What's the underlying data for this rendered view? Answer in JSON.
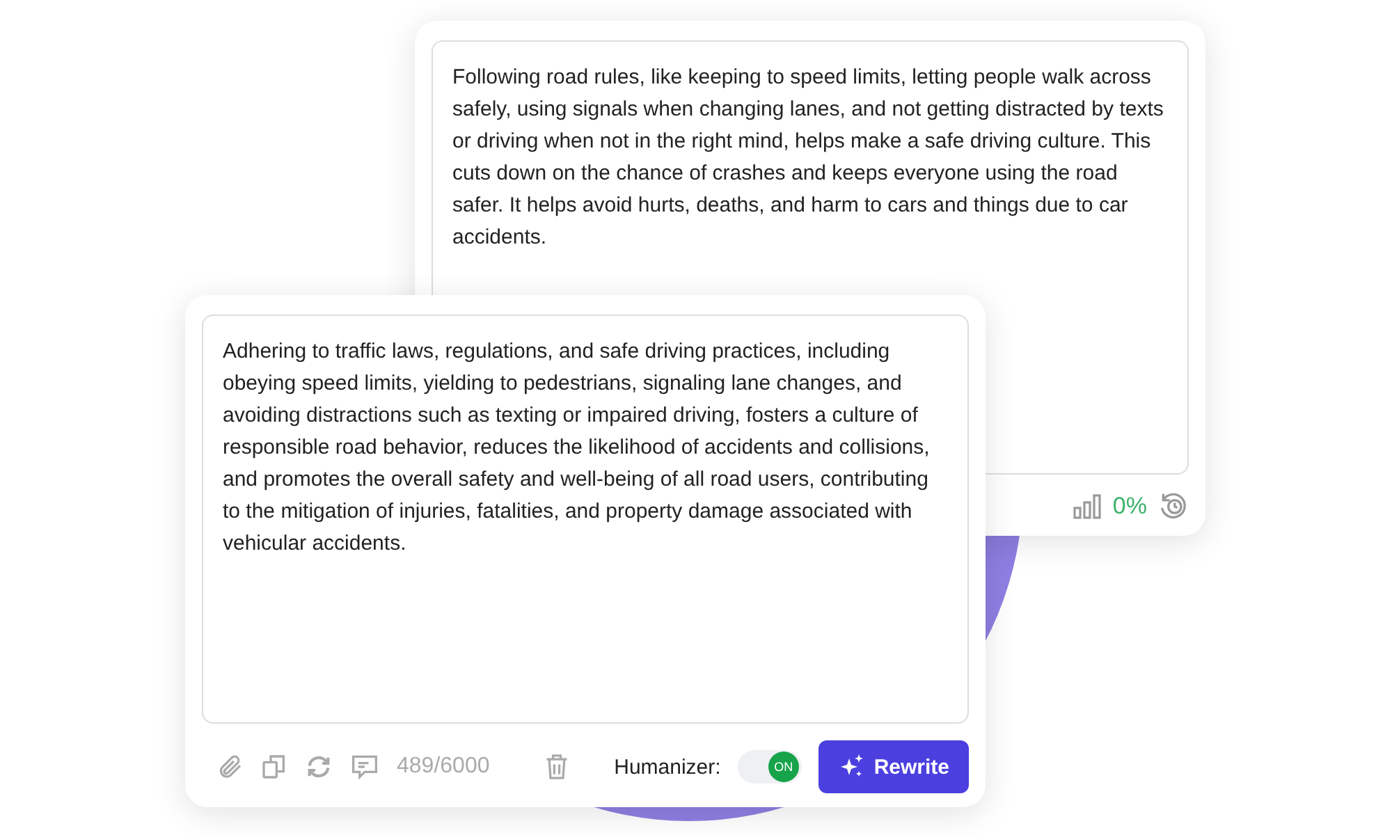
{
  "output_card": {
    "text": "Following road rules, like keeping to speed limits, letting people walk across safely, using signals when changing lanes, and not getting distracted by texts or driving when not in the right mind, helps make a safe driving culture. This cuts down on the chance of crashes and keeps everyone using the road safer. It helps avoid hurts, deaths, and harm to cars and things due to car accidents.",
    "score": "0%"
  },
  "input_card": {
    "text": "Adhering to traffic laws, regulations, and safe driving practices, including obeying speed limits, yielding to pedestrians, signaling lane changes, and avoiding distractions such as texting or impaired driving, fosters a culture of responsible road behavior, reduces the likelihood of accidents and collisions, and promotes the overall safety and well-being of all road users, contributing to the mitigation of injuries, fatalities, and property damage associated with vehicular accidents.",
    "counter": "489/6000",
    "humanizer": {
      "label": "Humanizer:",
      "on": true,
      "state_text": "ON"
    },
    "rewrite_button": "Rewrite"
  }
}
